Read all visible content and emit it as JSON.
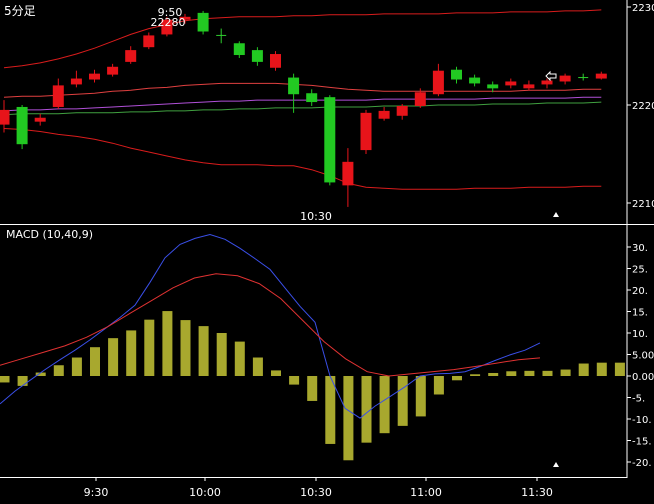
{
  "chart_data": [
    {
      "type": "candlestick",
      "title": "5分足",
      "ylim": [
        2208,
        2231
      ],
      "y_ticks": [
        "2230",
        "2220",
        "2210"
      ],
      "annotations": [
        {
          "text": "9:50",
          "x": "9:50"
        },
        {
          "text": "22280",
          "x": "9:50"
        },
        {
          "text": "10:30",
          "x": "10:30"
        }
      ],
      "candles": [
        {
          "open": 2218.0,
          "close": 2219.5,
          "high": 2220.5,
          "low": 2217.2
        },
        {
          "open": 2219.8,
          "close": 2216.0,
          "high": 2220.0,
          "low": 2215.5
        },
        {
          "open": 2218.3,
          "close": 2218.7,
          "high": 2219.1,
          "low": 2217.9
        },
        {
          "open": 2219.8,
          "close": 2222.0,
          "high": 2222.7,
          "low": 2219.6
        },
        {
          "open": 2222.1,
          "close": 2222.7,
          "high": 2223.5,
          "low": 2221.8
        },
        {
          "open": 2222.6,
          "close": 2223.2,
          "high": 2223.6,
          "low": 2222.3
        },
        {
          "open": 2223.1,
          "close": 2223.9,
          "high": 2224.2,
          "low": 2222.9
        },
        {
          "open": 2224.4,
          "close": 2225.6,
          "high": 2226.0,
          "low": 2224.2
        },
        {
          "open": 2225.9,
          "close": 2227.1,
          "high": 2227.4,
          "low": 2225.7
        },
        {
          "open": 2227.2,
          "close": 2228.7,
          "high": 2229.0,
          "low": 2227.0
        },
        {
          "open": 2228.7,
          "close": 2229.0,
          "high": 2229.3,
          "low": 2228.3
        },
        {
          "open": 2229.4,
          "close": 2227.5,
          "high": 2229.6,
          "low": 2227.2
        },
        {
          "open": 2227.1,
          "close": 2227.1,
          "high": 2227.8,
          "low": 2226.3
        },
        {
          "open": 2226.3,
          "close": 2225.1,
          "high": 2226.5,
          "low": 2224.8
        },
        {
          "open": 2225.6,
          "close": 2224.4,
          "high": 2225.9,
          "low": 2224.0
        },
        {
          "open": 2223.8,
          "close": 2225.2,
          "high": 2225.5,
          "low": 2223.5
        },
        {
          "open": 2222.8,
          "close": 2221.1,
          "high": 2223.2,
          "low": 2219.2
        },
        {
          "open": 2221.2,
          "close": 2220.3,
          "high": 2221.6,
          "low": 2219.9
        },
        {
          "open": 2220.8,
          "close": 2212.1,
          "high": 2221.0,
          "low": 2211.8
        },
        {
          "open": 2211.8,
          "close": 2214.2,
          "high": 2215.6,
          "low": 2209.6
        },
        {
          "open": 2215.4,
          "close": 2219.2,
          "high": 2219.5,
          "low": 2215.0
        },
        {
          "open": 2218.6,
          "close": 2219.4,
          "high": 2219.8,
          "low": 2218.4
        },
        {
          "open": 2218.9,
          "close": 2219.9,
          "high": 2220.1,
          "low": 2218.5
        },
        {
          "open": 2219.9,
          "close": 2221.3,
          "high": 2221.7,
          "low": 2219.7
        },
        {
          "open": 2221.1,
          "close": 2223.5,
          "high": 2224.2,
          "low": 2220.9
        },
        {
          "open": 2223.6,
          "close": 2222.6,
          "high": 2223.9,
          "low": 2222.2
        },
        {
          "open": 2222.8,
          "close": 2222.2,
          "high": 2223.1,
          "low": 2221.9
        },
        {
          "open": 2222.1,
          "close": 2221.7,
          "high": 2222.4,
          "low": 2221.3
        },
        {
          "open": 2222.0,
          "close": 2222.4,
          "high": 2222.7,
          "low": 2221.7
        },
        {
          "open": 2221.7,
          "close": 2222.1,
          "high": 2222.5,
          "low": 2221.5
        },
        {
          "open": 2222.1,
          "close": 2222.5,
          "high": 2222.7,
          "low": 2221.7
        },
        {
          "open": 2222.4,
          "close": 2223.0,
          "high": 2223.2,
          "low": 2222.1
        },
        {
          "open": 2222.8,
          "close": 2222.8,
          "high": 2223.2,
          "low": 2222.5
        },
        {
          "open": 2222.7,
          "close": 2223.2,
          "high": 2223.4,
          "low": 2222.6
        }
      ],
      "bollinger_upper": [
        2223.8,
        2224.0,
        2224.3,
        2224.7,
        2225.2,
        2225.8,
        2226.5,
        2227.2,
        2227.8,
        2228.2,
        2228.6,
        2228.8,
        2228.9,
        2229.0,
        2229.0,
        2229.0,
        2229.1,
        2229.1,
        2229.2,
        2229.2,
        2229.2,
        2229.3,
        2229.3,
        2229.3,
        2229.3,
        2229.4,
        2229.4,
        2229.4,
        2229.5,
        2229.5,
        2229.5,
        2229.6,
        2229.6,
        2229.7
      ],
      "bollinger_lower": [
        2217.6,
        2217.5,
        2217.3,
        2217.0,
        2216.8,
        2216.5,
        2216.1,
        2215.6,
        2215.2,
        2214.8,
        2214.4,
        2214.1,
        2213.9,
        2213.9,
        2213.9,
        2213.8,
        2213.8,
        2213.4,
        2212.8,
        2212.0,
        2211.6,
        2211.5,
        2211.4,
        2211.4,
        2211.4,
        2211.4,
        2211.5,
        2211.5,
        2211.5,
        2211.6,
        2211.6,
        2211.6,
        2211.7,
        2211.7
      ],
      "moving_avg_red": [
        2220.8,
        2220.9,
        2220.9,
        2221.0,
        2221.1,
        2221.2,
        2221.4,
        2221.5,
        2221.7,
        2221.8,
        2222.0,
        2222.1,
        2222.2,
        2222.2,
        2222.2,
        2222.2,
        2222.1,
        2222.0,
        2221.8,
        2221.6,
        2221.5,
        2221.4,
        2221.4,
        2221.4,
        2221.4,
        2221.4,
        2221.4,
        2221.4,
        2221.4,
        2221.5,
        2221.5,
        2221.5,
        2221.6,
        2221.6
      ],
      "moving_avg_purple": [
        2219.4,
        2219.5,
        2219.5,
        2219.6,
        2219.6,
        2219.7,
        2219.8,
        2219.9,
        2220.0,
        2220.1,
        2220.2,
        2220.3,
        2220.4,
        2220.4,
        2220.5,
        2220.5,
        2220.5,
        2220.5,
        2220.5,
        2220.5,
        2220.5,
        2220.6,
        2220.6,
        2220.6,
        2220.6,
        2220.6,
        2220.6,
        2220.7,
        2220.7,
        2220.7,
        2220.7,
        2220.7,
        2220.8,
        2220.8
      ],
      "moving_avg_green": [
        2219.0,
        2219.1,
        2219.1,
        2219.1,
        2219.2,
        2219.2,
        2219.2,
        2219.3,
        2219.3,
        2219.4,
        2219.4,
        2219.5,
        2219.5,
        2219.6,
        2219.6,
        2219.7,
        2219.7,
        2219.7,
        2219.8,
        2219.8,
        2219.8,
        2219.9,
        2219.9,
        2219.9,
        2220.0,
        2220.0,
        2220.0,
        2220.1,
        2220.1,
        2220.1,
        2220.2,
        2220.2,
        2220.2,
        2220.3
      ]
    },
    {
      "type": "bar+line",
      "title": "MACD (10,40,9)",
      "ylim": [
        -23,
        33
      ],
      "y_ticks": [
        "30.",
        "25.",
        "20.",
        "15.",
        "10.",
        "5.00",
        "0.00",
        "-5.",
        "-10.",
        "-15.",
        "-20."
      ],
      "histogram": [
        -1.5,
        -2.3,
        0.8,
        2.5,
        4.3,
        6.7,
        8.8,
        10.6,
        13.1,
        15.1,
        13.0,
        11.6,
        10.0,
        8.0,
        4.3,
        1.3,
        -2.0,
        -5.8,
        -15.8,
        -19.6,
        -15.5,
        -13.3,
        -11.6,
        -9.4,
        -4.3,
        -1.0,
        0.4,
        0.7,
        1.1,
        1.2,
        1.2,
        1.5,
        2.9,
        3.1,
        3.1
      ],
      "macd_line": [
        -6.5,
        -3.5,
        -1.0,
        1.5,
        3.8,
        6.0,
        8.4,
        11.0,
        13.6,
        16.5,
        21.8,
        27.5,
        30.6,
        32.0,
        32.9,
        31.8,
        29.7,
        27.3,
        24.8,
        20.5,
        16.2,
        12.5,
        0.0,
        -7.5,
        -9.8,
        -7.0,
        -4.8,
        -2.5,
        0.0,
        0.5,
        0.6,
        1.0,
        2.2,
        3.6,
        4.9,
        6.0,
        7.7
      ],
      "signal_line": [
        2.5,
        4.0,
        5.5,
        7.0,
        9.0,
        11.5,
        14.5,
        17.5,
        20.5,
        22.8,
        23.8,
        23.3,
        21.5,
        18.0,
        13.0,
        8.0,
        4.0,
        1.0,
        0.0,
        0.5,
        1.0,
        1.5,
        2.2,
        3.0,
        3.8,
        4.2
      ],
      "x_labels": [
        "9:30",
        "10:00",
        "10:30",
        "11:00",
        "11:30"
      ]
    }
  ],
  "colors": {
    "up": "#e8141a",
    "down": "#22c922",
    "doji": "#2fcf2f",
    "bollinger": "#d91c1c",
    "ma_red": "#e04040",
    "ma_purple": "#b050d8",
    "ma_green": "#40a040",
    "macd_line": "#3a4fe8",
    "signal_line": "#e03232",
    "histogram": "#a8a82e",
    "grid": "#ffffff",
    "text": "#ffffff"
  }
}
